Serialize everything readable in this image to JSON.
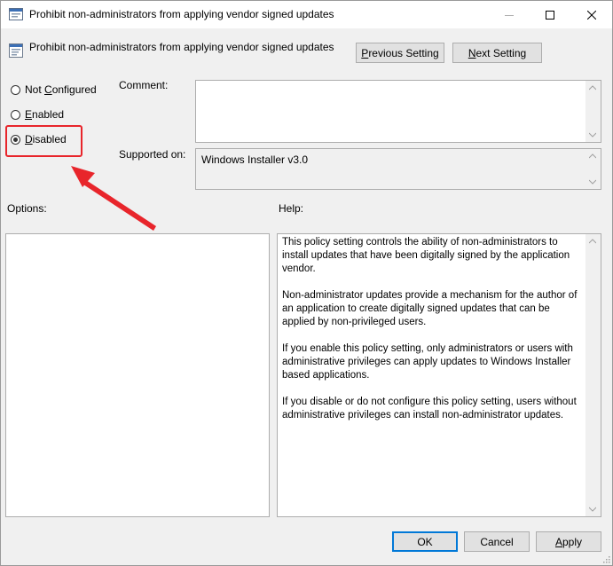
{
  "window": {
    "title": "Prohibit non-administrators from applying vendor signed updates",
    "controls": {
      "minimize": "minimize",
      "maximize": "maximize",
      "close": "close"
    }
  },
  "header": {
    "setting_name": "Prohibit non-administrators from applying vendor signed updates",
    "previous_label_pre": "",
    "previous_label_key": "P",
    "previous_label_post": "revious Setting",
    "next_label_key": "N",
    "next_label_post": "ext Setting"
  },
  "state": {
    "options": [
      {
        "key": "C",
        "pre": "Not ",
        "post": "onfigured",
        "checked": false
      },
      {
        "key": "E",
        "pre": "",
        "post": "nabled",
        "checked": false
      },
      {
        "key": "D",
        "pre": "",
        "post": "isabled",
        "checked": true
      }
    ]
  },
  "comment": {
    "label": "Comment:",
    "value": ""
  },
  "supported": {
    "label": "Supported on:",
    "value": "Windows Installer v3.0"
  },
  "options_panel": {
    "label": "Options:"
  },
  "help_panel": {
    "label": "Help:",
    "paragraphs": [
      "This policy setting controls the ability of non-administrators to install updates that have been digitally signed by the application vendor.",
      "Non-administrator updates provide a mechanism for the author of an application to create digitally signed updates that can be applied by non-privileged users.",
      "If you enable this policy setting, only administrators or users with administrative privileges can apply updates to Windows Installer based applications.",
      "If you disable or do not configure this policy setting, users without administrative privileges can install non-administrator updates."
    ]
  },
  "footer": {
    "ok": "OK",
    "cancel": "Cancel",
    "apply_key": "A",
    "apply_post": "pply"
  },
  "colors": {
    "annotation": "#e8252b",
    "accent": "#0078d7"
  }
}
